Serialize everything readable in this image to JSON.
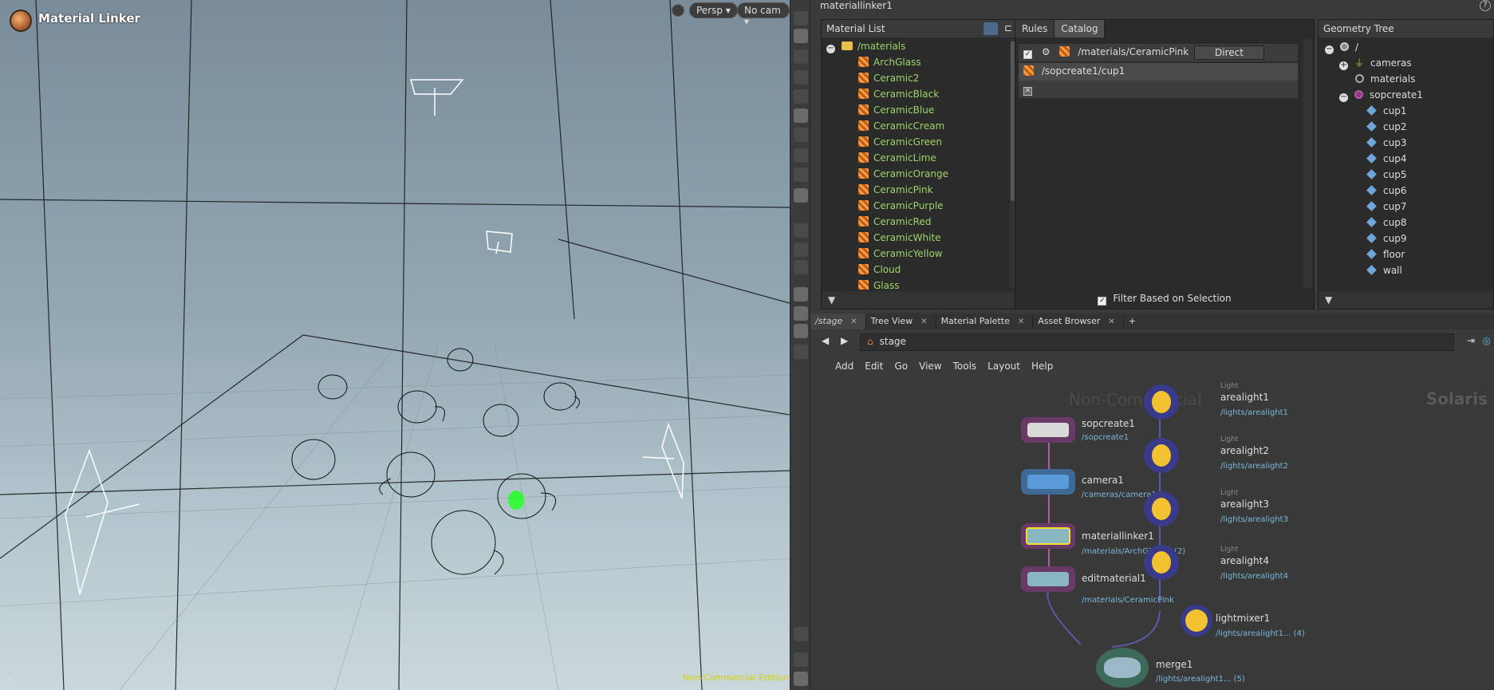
{
  "viewport": {
    "title": "Material Linker",
    "persp_label": "Persp",
    "cam_label": "No cam",
    "watermark": "Non-Commercial Edition"
  },
  "header": {
    "node_path": "materiallinker1"
  },
  "material_list": {
    "title": "Material List",
    "root": "/materials",
    "items": [
      "ArchGlass",
      "Ceramic2",
      "CeramicBlack",
      "CeramicBlue",
      "CeramicCream",
      "CeramicGreen",
      "CeramicLime",
      "CeramicOrange",
      "CeramicPink",
      "CeramicPurple",
      "CeramicRed",
      "CeramicWhite",
      "CeramicYellow",
      "Cloud",
      "Glass"
    ]
  },
  "rules": {
    "tabs": [
      "Rules",
      "Catalog"
    ],
    "rule_material": "/materials/CeramicPink",
    "rule_mode": "Direct",
    "rule_geo": "/sopcreate1/cup1",
    "filter_label": "Filter Based on Selection"
  },
  "geometry_tree": {
    "title": "Geometry Tree",
    "root": "/",
    "cameras": "cameras",
    "materials": "materials",
    "sopcreate": "sopcreate1",
    "children": [
      "cup1",
      "cup2",
      "cup3",
      "cup4",
      "cup5",
      "cup6",
      "cup7",
      "cup8",
      "cup9",
      "floor",
      "wall"
    ]
  },
  "network": {
    "tabs": [
      "/stage",
      "Tree View",
      "Material Palette",
      "Asset Browser"
    ],
    "path": "stage",
    "menu": [
      "Add",
      "Edit",
      "Go",
      "View",
      "Tools",
      "Layout",
      "Help"
    ],
    "watermark_left": "Non-Commercial",
    "watermark_right": "Solaris",
    "nodes": {
      "sopcreate1": {
        "name": "sopcreate1",
        "sub": "/sopcreate1"
      },
      "camera1": {
        "name": "camera1",
        "sub": "/cameras/camera1"
      },
      "materiallinker1": {
        "name": "materiallinker1",
        "sub": "/materials/ArchGlass... (2)"
      },
      "editmaterial1": {
        "name": "editmaterial1",
        "sub": "/materials/CeramicPink"
      },
      "arealight1": {
        "type": "Light",
        "name": "arealight1",
        "sub": "/lights/arealight1"
      },
      "arealight2": {
        "type": "Light",
        "name": "arealight2",
        "sub": "/lights/arealight2"
      },
      "arealight3": {
        "type": "Light",
        "name": "arealight3",
        "sub": "/lights/arealight3"
      },
      "arealight4": {
        "type": "Light",
        "name": "arealight4",
        "sub": "/lights/arealight4"
      },
      "lightmixer1": {
        "name": "lightmixer1",
        "sub": "/lights/arealight1... (4)"
      },
      "merge1": {
        "name": "merge1",
        "sub": "/lights/arealight1... (5)"
      }
    }
  },
  "colors": {
    "material_text": "#9ed36a",
    "light_node": "#f2c230",
    "light_glow": "#3a3a8a",
    "path_text": "#7ab8d8"
  }
}
